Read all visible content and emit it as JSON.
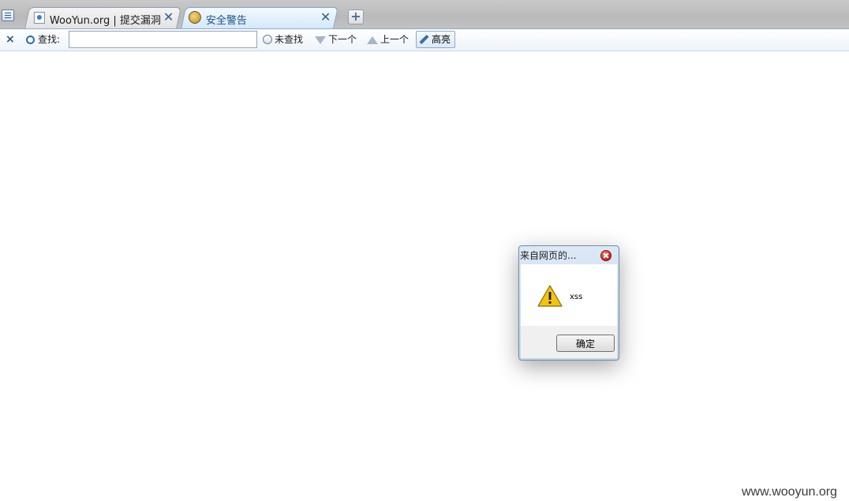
{
  "browser": {
    "tabs": [
      {
        "title": "WooYun.org | 提交漏洞",
        "active": false,
        "favicon": "document-icon"
      },
      {
        "title": "安全警告",
        "active": true,
        "favicon": "shield-icon"
      }
    ],
    "tab_close_glyph": "✕",
    "new_tab_glyph": "+"
  },
  "find_bar": {
    "close_glyph": "×",
    "label": "查找:",
    "input_value": "",
    "status": "未查找",
    "next_label": "下一个",
    "prev_label": "上一个",
    "highlight_label": "高亮"
  },
  "dialog": {
    "title": "来自网页的...",
    "message": "xss",
    "ok_label": "确定",
    "icon": "warning-icon"
  },
  "watermark": "www.wooyun.org",
  "colors": {
    "accent": "#2c6db1",
    "active_tab_text": "#1f4f86",
    "warning_yellow": "#f2c40c",
    "close_red": "#d2281a"
  }
}
